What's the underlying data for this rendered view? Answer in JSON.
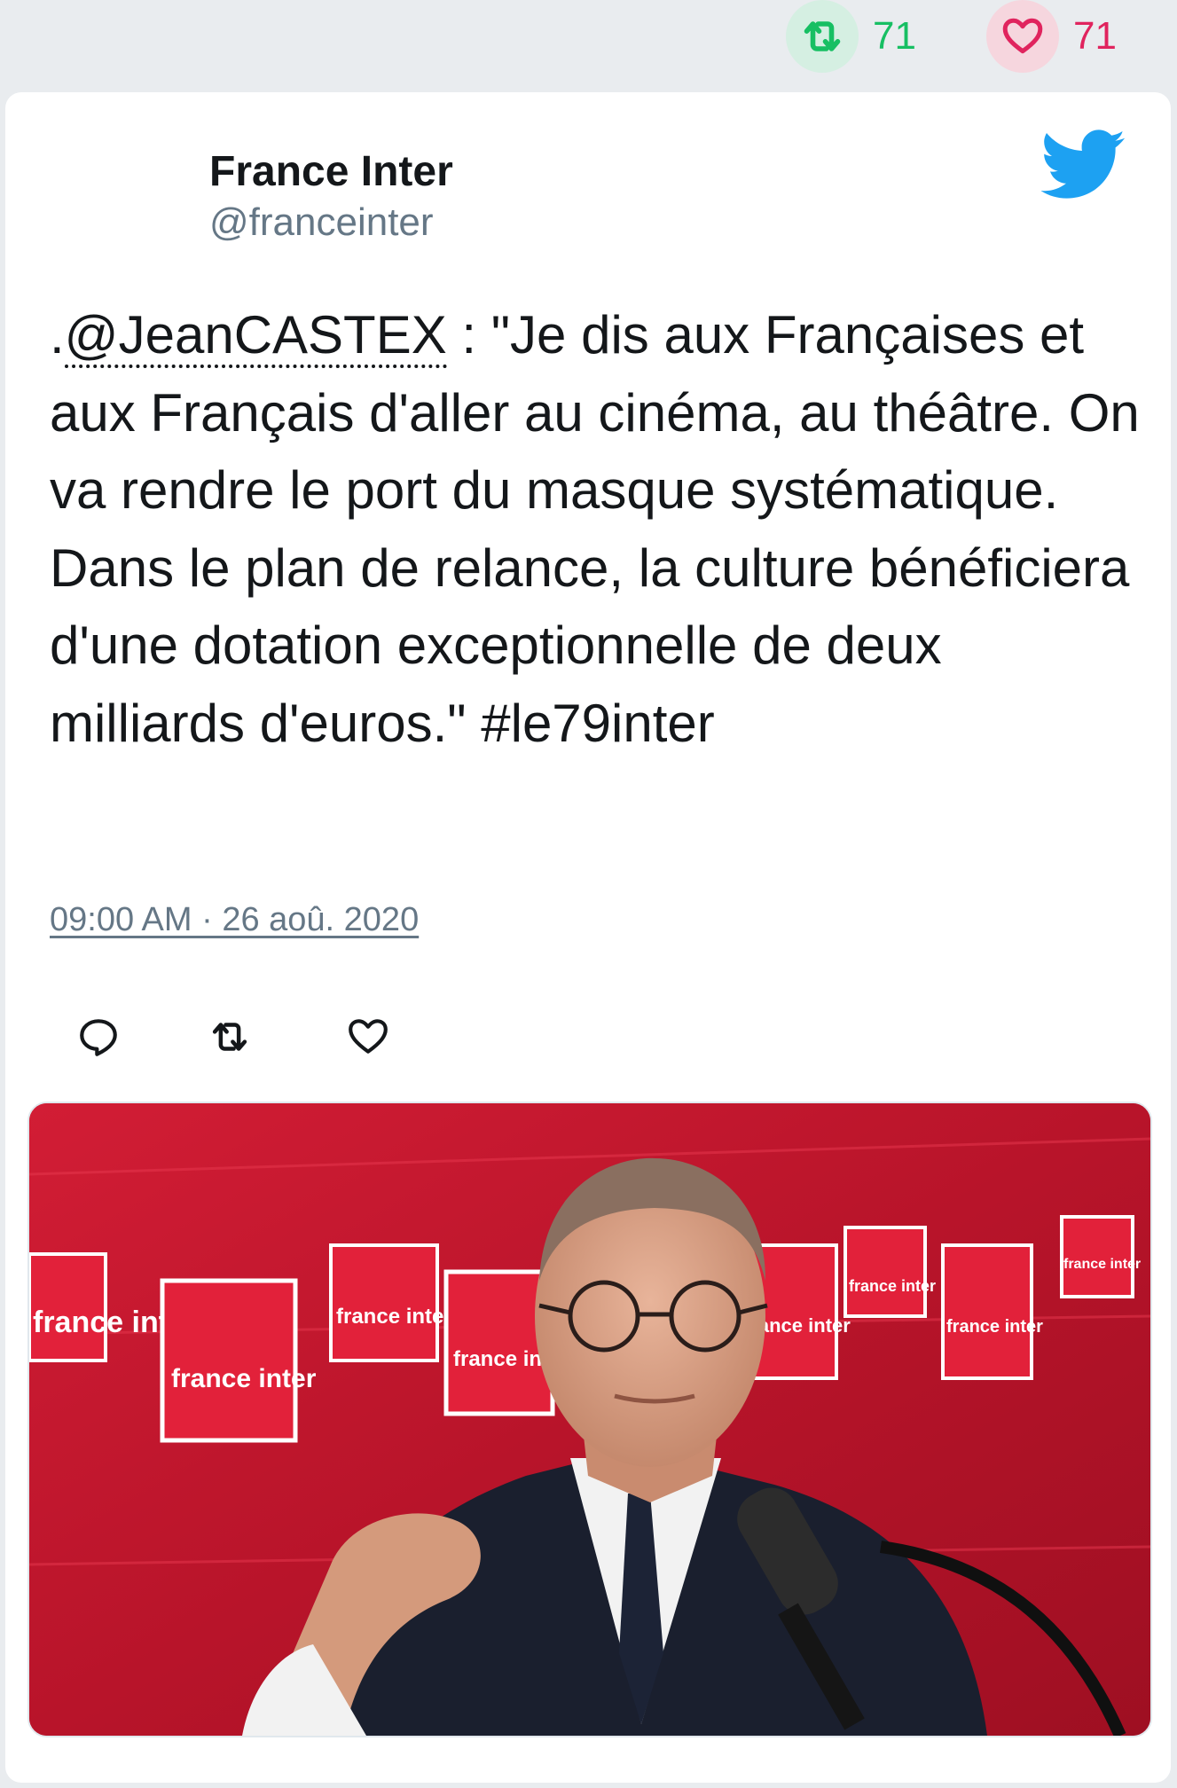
{
  "stats": {
    "retweet_count": "71",
    "like_count": "71",
    "retweet_icon": "retweet-icon",
    "like_icon": "heart-icon",
    "retweet_color": "#17bf63",
    "like_color": "#e0245e"
  },
  "tweet": {
    "author_name": "France Inter",
    "author_handle": "@franceinter",
    "text_prefix": ".",
    "mention": "@JeanCASTEX",
    "text_body": " : \"Je dis aux Françaises et aux Français d'aller au cinéma, au théâtre. On va rendre le port du masque systématique. Dans le plan de relance, la culture bénéficiera d'une dotation exceptionnelle de deux milliards d'euros.\" #le79inter",
    "timestamp": "09:00 AM · 26 aoû. 2020"
  },
  "media": {
    "backdrop_logos": [
      "france inter",
      "france inter",
      "france inter",
      "france inter",
      "france inter",
      "france inter",
      "france inter",
      "france inter"
    ]
  },
  "colors": {
    "background": "#e9ecef",
    "card": "#ffffff",
    "twitter_blue": "#1da1f2",
    "text": "#14171a",
    "muted": "#657786",
    "studio_red": "#c0182a"
  }
}
